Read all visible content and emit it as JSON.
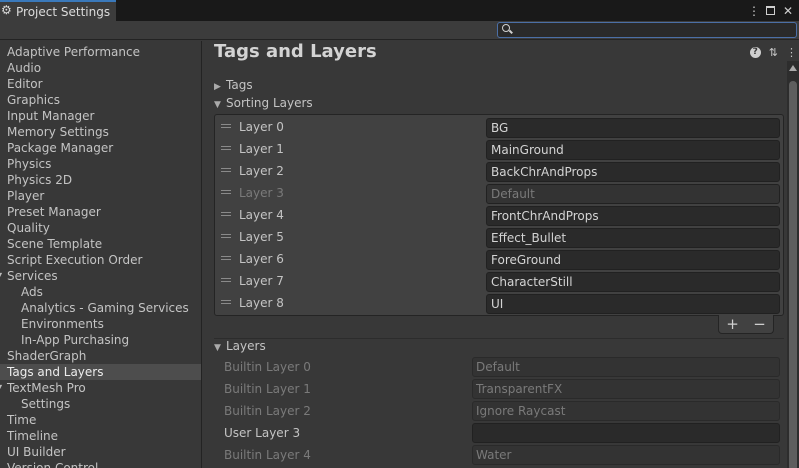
{
  "window": {
    "title": "Project Settings"
  },
  "sidebar": {
    "items": [
      {
        "label": "Adaptive Performance"
      },
      {
        "label": "Audio"
      },
      {
        "label": "Editor"
      },
      {
        "label": "Graphics"
      },
      {
        "label": "Input Manager"
      },
      {
        "label": "Memory Settings"
      },
      {
        "label": "Package Manager"
      },
      {
        "label": "Physics"
      },
      {
        "label": "Physics 2D"
      },
      {
        "label": "Player"
      },
      {
        "label": "Preset Manager"
      },
      {
        "label": "Quality"
      },
      {
        "label": "Scene Template"
      },
      {
        "label": "Script Execution Order"
      },
      {
        "label": "Services"
      },
      {
        "label": "Ads"
      },
      {
        "label": "Analytics - Gaming Services"
      },
      {
        "label": "Environments"
      },
      {
        "label": "In-App Purchasing"
      },
      {
        "label": "ShaderGraph"
      },
      {
        "label": "Tags and Layers"
      },
      {
        "label": "TextMesh Pro"
      },
      {
        "label": "Settings"
      },
      {
        "label": "Time"
      },
      {
        "label": "Timeline"
      },
      {
        "label": "UI Builder"
      },
      {
        "label": "Version Control"
      }
    ],
    "selected": "Tags and Layers"
  },
  "main": {
    "title": "Tags and Layers",
    "tags_label": "Tags",
    "sorting_layers_label": "Sorting Layers",
    "sorting_layers": [
      {
        "label": "Layer 0",
        "value": "BG"
      },
      {
        "label": "Layer 1",
        "value": "MainGround"
      },
      {
        "label": "Layer 2",
        "value": "BackChrAndProps"
      },
      {
        "label": "Layer 3",
        "value": "Default"
      },
      {
        "label": "Layer 4",
        "value": "FrontChrAndProps"
      },
      {
        "label": "Layer 5",
        "value": "Effect_Bullet"
      },
      {
        "label": "Layer 6",
        "value": "ForeGround"
      },
      {
        "label": "Layer 7",
        "value": "CharacterStill"
      },
      {
        "label": "Layer 8",
        "value": "UI"
      }
    ],
    "add_label": "+",
    "remove_label": "−",
    "layers_label": "Layers",
    "layers": [
      {
        "label": "Builtin Layer 0",
        "value": "Default"
      },
      {
        "label": "Builtin Layer 1",
        "value": "TransparentFX"
      },
      {
        "label": "Builtin Layer 2",
        "value": "Ignore Raycast"
      },
      {
        "label": "User Layer 3",
        "value": ""
      },
      {
        "label": "Builtin Layer 4",
        "value": "Water"
      }
    ]
  },
  "icons": {
    "settings": "gear-icon",
    "menu": "kebab-menu-icon",
    "maximize": "maximize-icon",
    "search": "search-icon",
    "help": "help-icon",
    "presets": "preset-sliders-icon",
    "drag": "drag-handle-icon"
  },
  "colors": {
    "background": "#383838",
    "accent": "#3a79bb",
    "selected_row": "#4d4d4d"
  }
}
